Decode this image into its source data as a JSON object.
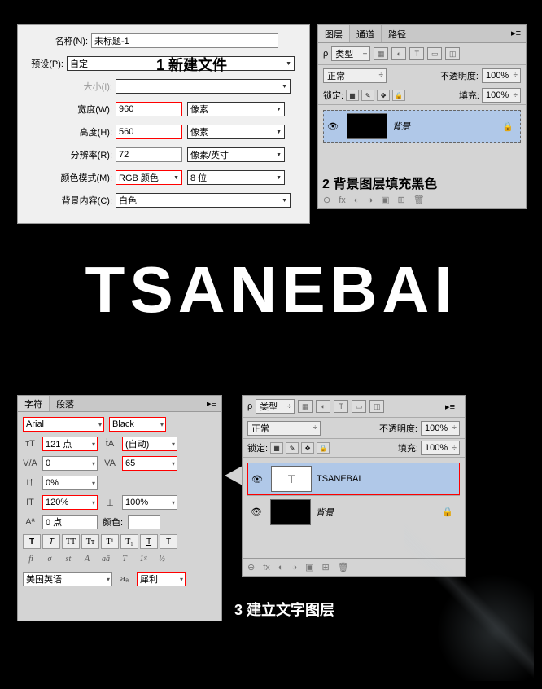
{
  "step1": {
    "title": "1 新建文件",
    "name_label": "名称(N):",
    "name_value": "未标题-1",
    "preset_label": "预设(P):",
    "preset_value": "自定",
    "size_label": "大小(I):",
    "width_label": "宽度(W):",
    "width_value": "960",
    "width_unit": "像素",
    "height_label": "高度(H):",
    "height_value": "560",
    "height_unit": "像素",
    "res_label": "分辨率(R):",
    "res_value": "72",
    "res_unit": "像素/英寸",
    "colormode_label": "颜色模式(M):",
    "colormode_value": "RGB 颜色",
    "bitdepth_value": "8 位",
    "bg_label": "背景内容(C):",
    "bg_value": "白色"
  },
  "step2": {
    "title": "2 背景图层填充黑色",
    "tab1": "图层",
    "tab2": "通道",
    "tab3": "路径",
    "filter_label": "类型",
    "blend": "正常",
    "opacity_label": "不透明度:",
    "opacity_value": "100%",
    "lock_label": "锁定:",
    "fill_label": "填充:",
    "fill_value": "100%",
    "layer_name": "背景"
  },
  "bigtext": "TSANEBAI",
  "step3": {
    "title": "3 建立文字图层",
    "tab1": "字符",
    "tab2": "段落",
    "font": "Arial",
    "weight": "Black",
    "size": "121 点",
    "leading": "(自动)",
    "va": "0",
    "tracking": "65",
    "vscale_icon": "あ",
    "vscale": "0%",
    "hscale": "120%",
    "hscale2": "100%",
    "baseline_label": "Aª",
    "baseline": "0 点",
    "color_label": "颜色:",
    "lang": "美国英语",
    "aa": "犀利",
    "layer_name": "TSANEBAI",
    "bg_layer": "背景"
  }
}
